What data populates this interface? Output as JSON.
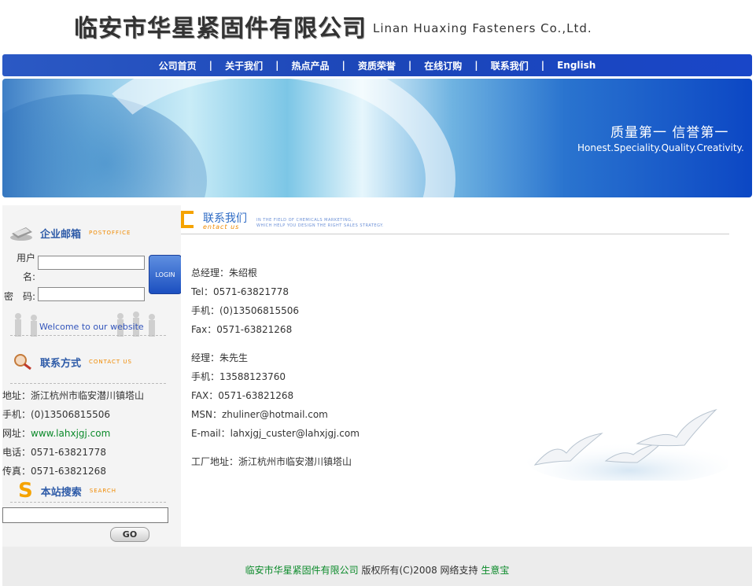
{
  "header": {
    "company_cn": "临安市华星紧固件有限公司",
    "company_en": "Linan Huaxing Fasteners Co.,Ltd."
  },
  "nav": {
    "items": [
      "公司首页",
      "关于我们",
      "热点产品",
      "资质荣誉",
      "在线订购",
      "联系我们",
      "English"
    ],
    "separator": "|"
  },
  "banner": {
    "slogan_cn": "质量第一  信誉第一",
    "slogan_en": "Honest.Speciality.Quality.Creativity."
  },
  "sidebar": {
    "mail": {
      "title": "企业邮箱",
      "subtitle": "POSTOFFICE",
      "username_label": "用户名:",
      "password_label": "密　码:",
      "login_label": "LOGIN",
      "welcome": "Welcome to our website"
    },
    "contact": {
      "title": "联系方式",
      "subtitle": "CONTACT US",
      "address": "地址：浙江杭州市临安潜川镇塔山",
      "mobile": "手机：(0)13506815506",
      "website_label": "网址：",
      "website": "www.lahxjgj.com",
      "phone": "电话：0571-63821778",
      "fax": "传真：0571-63821268"
    },
    "search": {
      "icon_letter": "S",
      "title": "本站搜索",
      "subtitle": "SEARCH",
      "input_value": "",
      "go_label": "GO"
    }
  },
  "main": {
    "section": {
      "title": "联系我们",
      "subtitle": "entact us",
      "desc_line1": "IN THE FIELD OF CHEMICALS MARKETING,",
      "desc_line2": "WHICH HELP YOU DESIGN THE RIGHT SALES STRATEGY."
    },
    "block1": [
      "总经理：朱绍根",
      "Tel：0571-63821778",
      "手机：(0)13506815506",
      "Fax：0571-63821268"
    ],
    "block2": [
      "经理：朱先生",
      "手机：13588123760",
      "FAX：0571-63821268",
      "MSN：zhuliner@hotmail.com",
      "E-mail：lahxjgj_custer@lahxjgj.com"
    ],
    "factory": "工厂地址：浙江杭州市临安潜川镇塔山"
  },
  "footer": {
    "company": "临安市华星紧固件有限公司",
    "copyright": " 版权所有(C)2008 网络支持 ",
    "support": "生意宝"
  },
  "colors": {
    "nav_blue": "#1c46b8",
    "title_blue": "#2e5ba8",
    "accent_orange": "#f08a00",
    "link_green": "#0b8a2a"
  }
}
